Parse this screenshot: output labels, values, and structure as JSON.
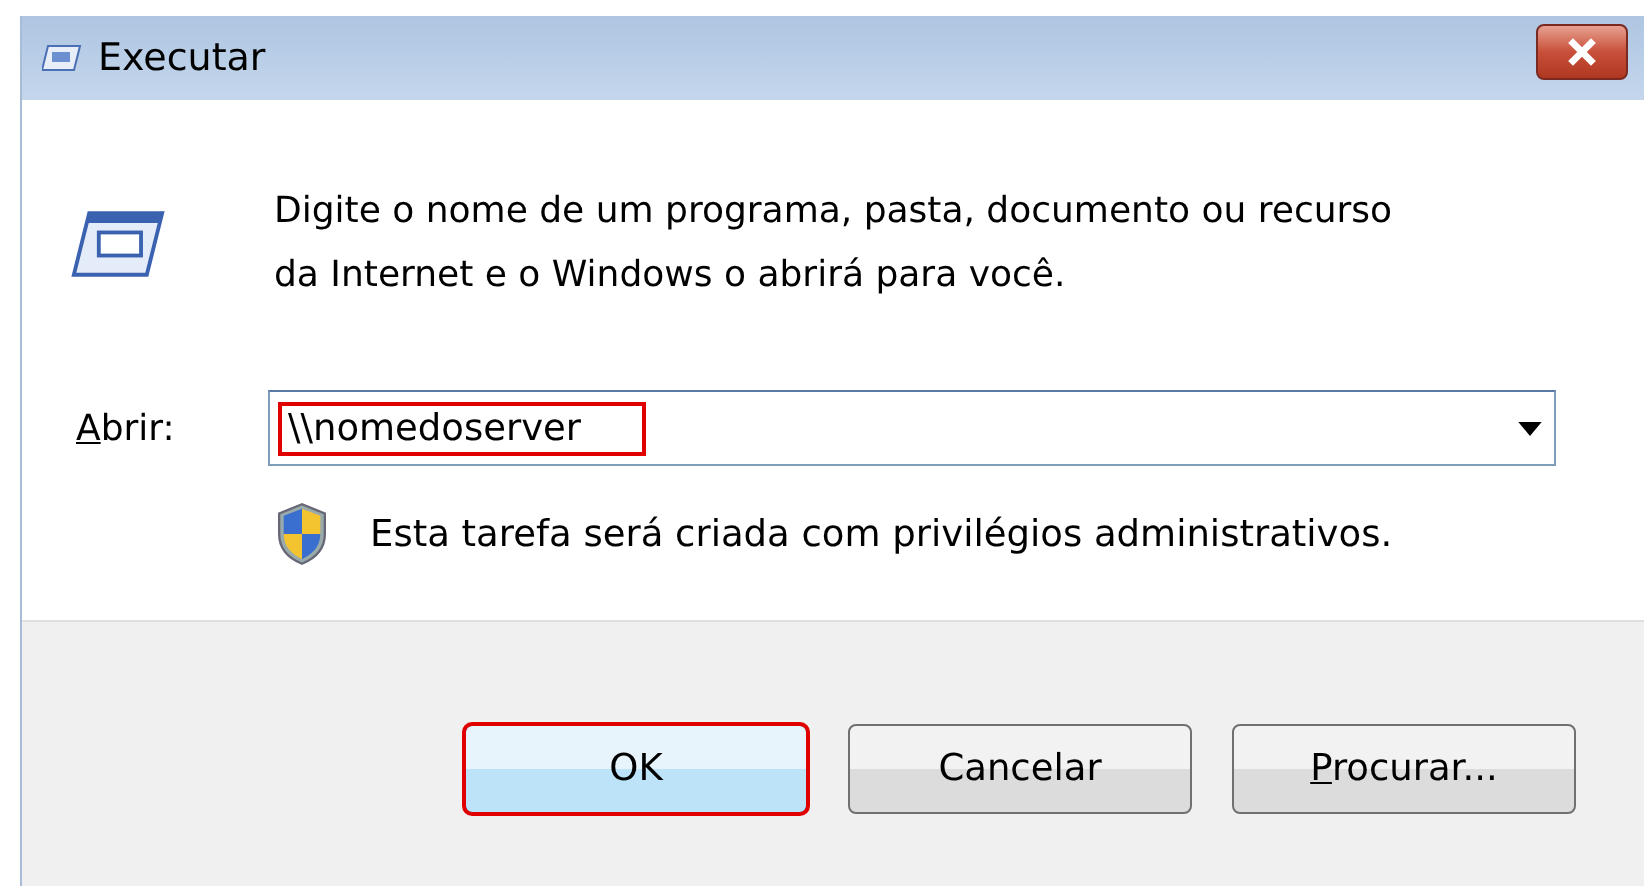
{
  "window": {
    "title": "Executar"
  },
  "message": "Digite o nome de um programa, pasta, documento ou recurso da Internet e o Windows o abrirá para você.",
  "open_field": {
    "label": "Abrir:",
    "label_mnemonic": true,
    "value": "\\\\nomedoserver",
    "highlighted": true
  },
  "admin_note": "Esta tarefa será criada com privilégios administrativos.",
  "buttons": [
    {
      "label": "OK",
      "default": true,
      "mnemonic": false,
      "highlighted": true
    },
    {
      "label": "Cancelar",
      "default": false,
      "mnemonic": false,
      "highlighted": false
    },
    {
      "label": "Procurar...",
      "default": false,
      "mnemonic": true,
      "highlighted": false
    }
  ]
}
